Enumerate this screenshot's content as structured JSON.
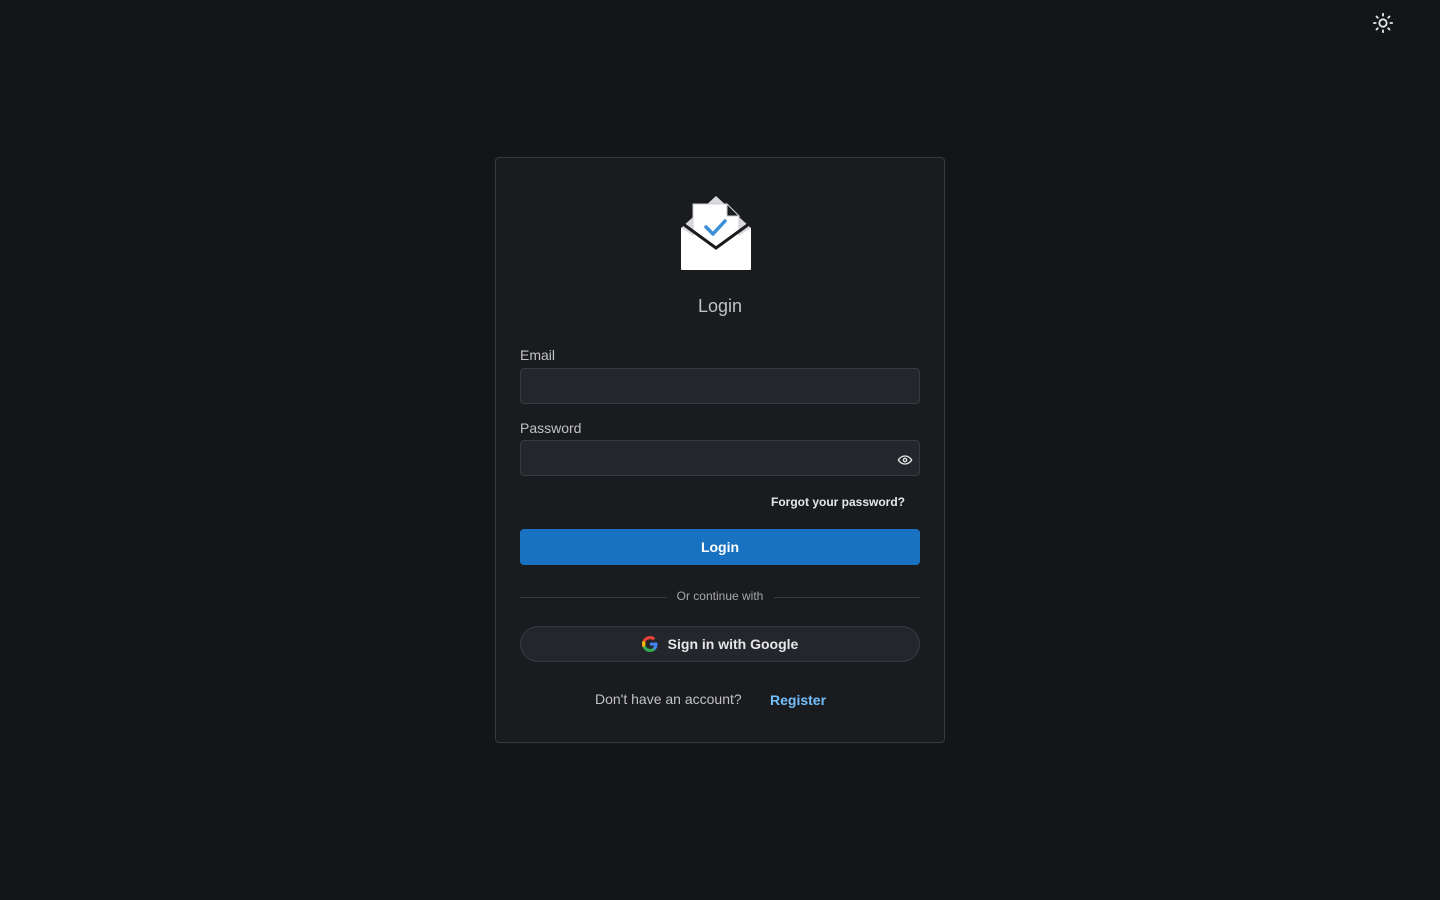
{
  "header": {
    "theme_toggle_icon": "sun-icon"
  },
  "login_card": {
    "logo_icon": "envelope-check-icon",
    "title": "Login",
    "email": {
      "label": "Email",
      "value": "",
      "placeholder": ""
    },
    "password": {
      "label": "Password",
      "value": "",
      "placeholder": "",
      "toggle_icon": "eye-icon"
    },
    "forgot_password_label": "Forgot your password?",
    "login_button_label": "Login",
    "divider_text": "Or continue with",
    "google_button_label": "Sign in with Google",
    "google_icon": "google-icon",
    "footer_text": "Don't have an account?",
    "register_label": "Register"
  },
  "colors": {
    "background": "#141517",
    "card": "#1a1b1e",
    "primary": "#1971c2",
    "link": "#74c0fc"
  }
}
